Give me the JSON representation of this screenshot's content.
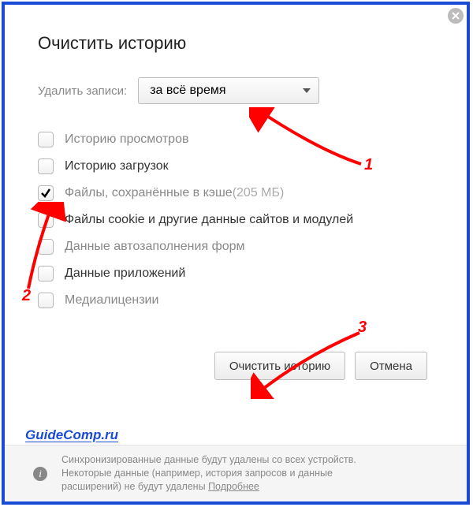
{
  "dialog": {
    "title": "Очистить историю",
    "delete_label": "Удалить записи:",
    "range_value": "за всё время"
  },
  "options": [
    {
      "label": "Историю просмотров",
      "checked": false,
      "dark": false,
      "sub": ""
    },
    {
      "label": "Историю загрузок",
      "checked": false,
      "dark": true,
      "sub": ""
    },
    {
      "label": "Файлы, сохранённые в кэше",
      "checked": true,
      "dark": false,
      "sub": " (205 МБ)"
    },
    {
      "label": "Файлы cookie и другие данные сайтов и модулей",
      "checked": false,
      "dark": true,
      "sub": ""
    },
    {
      "label": "Данные автозаполнения форм",
      "checked": false,
      "dark": false,
      "sub": ""
    },
    {
      "label": "Данные приложений",
      "checked": false,
      "dark": true,
      "sub": ""
    },
    {
      "label": "Медиалицензии",
      "checked": false,
      "dark": false,
      "sub": ""
    }
  ],
  "buttons": {
    "clear": "Очистить историю",
    "cancel": "Отмена"
  },
  "footer": {
    "line1": "Синхронизированные данные будут удалены со всех устройств.",
    "line2a": "Некоторые данные (например, история запросов и данные",
    "line2b": "расширений) не будут удалены ",
    "more": "Подробнее"
  },
  "watermark": "GuideComp.ru",
  "anno": {
    "n1": "1",
    "n2": "2",
    "n3": "3"
  }
}
